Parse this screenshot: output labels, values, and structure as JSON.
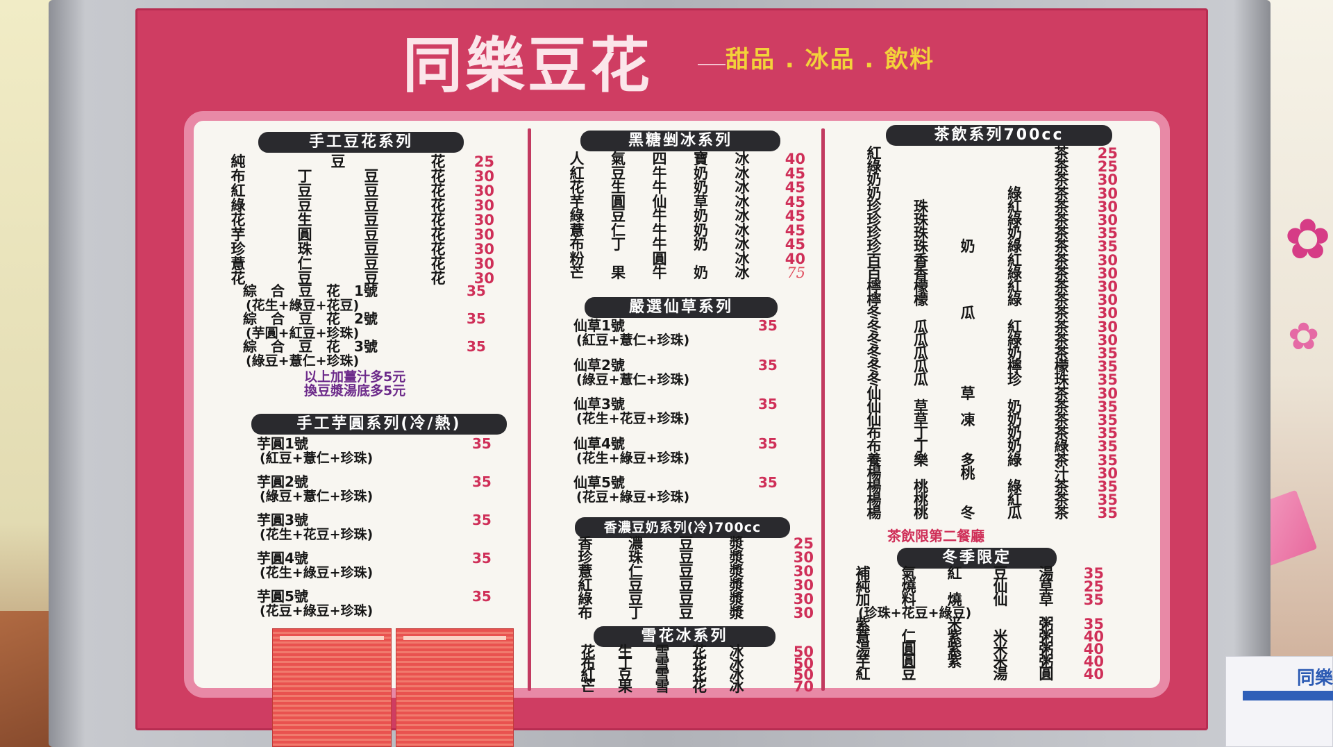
{
  "brand": {
    "name": "同樂豆花",
    "slogan": "甜品 . 冰品 . 飲料"
  },
  "colors": {
    "board": "#cf3d62",
    "price": "#cf2f58",
    "header_bg": "#2a2a2e",
    "inner": "#f8f6f1",
    "accent_note": "#6c2a8a"
  },
  "douhua": {
    "title": "手工豆花系列",
    "items": [
      {
        "name": [
          "純",
          "豆",
          "花"
        ],
        "price": "25"
      },
      {
        "name": [
          "布",
          "丁",
          "豆",
          "花"
        ],
        "price": "30"
      },
      {
        "name": [
          "紅",
          "豆",
          "豆",
          "花"
        ],
        "price": "30"
      },
      {
        "name": [
          "綠",
          "豆",
          "豆",
          "花"
        ],
        "price": "30"
      },
      {
        "name": [
          "花",
          "生",
          "豆",
          "花"
        ],
        "price": "30"
      },
      {
        "name": [
          "芋",
          "圓",
          "豆",
          "花"
        ],
        "price": "30"
      },
      {
        "name": [
          "珍",
          "珠",
          "豆",
          "花"
        ],
        "price": "30"
      },
      {
        "name": [
          "薏",
          "仁",
          "豆",
          "花"
        ],
        "price": "30"
      },
      {
        "name": [
          "花",
          "豆",
          "豆",
          "花"
        ],
        "price": "30"
      }
    ],
    "combos": [
      {
        "title": "綜　合　豆　花　1號",
        "price": "35",
        "sub": "(花生+綠豆+花豆)"
      },
      {
        "title": "綜　合　豆　花　2號",
        "price": "35",
        "sub": "(芋圓+紅豆+珍珠)"
      },
      {
        "title": "綜　合　豆　花　3號",
        "price": "35",
        "sub": "(綠豆+薏仁+珍珠)"
      }
    ],
    "notes": [
      "以上加薑汁多5元",
      "換豆漿湯底多5元"
    ]
  },
  "taro": {
    "title": "手工芋圓系列(冷/熱)",
    "items": [
      {
        "title": "芋圓1號",
        "price": "35",
        "sub": "(紅豆+薏仁+珍珠)"
      },
      {
        "title": "芋圓2號",
        "price": "35",
        "sub": "(綠豆+薏仁+珍珠)"
      },
      {
        "title": "芋圓3號",
        "price": "35",
        "sub": "(花生+花豆+珍珠)"
      },
      {
        "title": "芋圓4號",
        "price": "35",
        "sub": "(花生+綠豆+珍珠)"
      },
      {
        "title": "芋圓5號",
        "price": "35",
        "sub": "(花豆+綠豆+珍珠)"
      }
    ]
  },
  "brownsugar": {
    "title": "黑糖剉冰系列",
    "items": [
      {
        "name": [
          "人",
          "氣",
          "四",
          "寶",
          "冰"
        ],
        "price": "40"
      },
      {
        "name": [
          "紅",
          "豆",
          "牛",
          "奶",
          "冰"
        ],
        "price": "45"
      },
      {
        "name": [
          "花",
          "生",
          "牛",
          "奶",
          "冰"
        ],
        "price": "45"
      },
      {
        "name": [
          "芋",
          "圓",
          "仙",
          "草",
          "冰"
        ],
        "price": "45"
      },
      {
        "name": [
          "綠",
          "豆",
          "牛",
          "奶",
          "冰"
        ],
        "price": "45"
      },
      {
        "name": [
          "薏",
          "仁",
          "牛",
          "奶",
          "冰"
        ],
        "price": "45"
      },
      {
        "name": [
          "布",
          "丁",
          "牛",
          "奶",
          "冰"
        ],
        "price": "45"
      },
      {
        "name": [
          "粉",
          "",
          "圓",
          "",
          "冰"
        ],
        "price": "40"
      },
      {
        "name": [
          "芒",
          "果",
          "牛",
          "奶",
          "冰"
        ],
        "price": "75",
        "handwritten": true
      }
    ]
  },
  "grassjelly": {
    "title": "嚴選仙草系列",
    "items": [
      {
        "title": "仙草1號",
        "price": "35",
        "sub": "(紅豆+薏仁+珍珠)"
      },
      {
        "title": "仙草2號",
        "price": "35",
        "sub": "(綠豆+薏仁+珍珠)"
      },
      {
        "title": "仙草3號",
        "price": "35",
        "sub": "(花生+花豆+珍珠)"
      },
      {
        "title": "仙草4號",
        "price": "35",
        "sub": "(花生+綠豆+珍珠)"
      },
      {
        "title": "仙草5號",
        "price": "35",
        "sub": "(花豆+綠豆+珍珠)"
      }
    ]
  },
  "soymilk": {
    "title": "香濃豆奶系列(冷)700cc",
    "items": [
      {
        "name": [
          "香",
          "濃",
          "豆",
          "漿"
        ],
        "price": "25"
      },
      {
        "name": [
          "珍",
          "珠",
          "豆",
          "漿"
        ],
        "price": "30"
      },
      {
        "name": [
          "薏",
          "仁",
          "豆",
          "漿"
        ],
        "price": "30"
      },
      {
        "name": [
          "紅",
          "豆",
          "豆",
          "漿"
        ],
        "price": "30"
      },
      {
        "name": [
          "綠",
          "豆",
          "豆",
          "漿"
        ],
        "price": "30"
      },
      {
        "name": [
          "布",
          "丁",
          "豆",
          "漿"
        ],
        "price": "30"
      }
    ]
  },
  "snow": {
    "title": "雪花冰系列",
    "items": [
      {
        "name": [
          "花",
          "生",
          "雪",
          "花",
          "冰"
        ],
        "price": "50"
      },
      {
        "name": [
          "布",
          "丁",
          "雪",
          "花",
          "冰"
        ],
        "price": "50"
      },
      {
        "name": [
          "紅",
          "豆",
          "雪",
          "花",
          "冰"
        ],
        "price": "50"
      },
      {
        "name": [
          "芒",
          "果",
          "雪",
          "花",
          "冰"
        ],
        "price": "70"
      }
    ]
  },
  "tea": {
    "title": "茶飲系列700cc",
    "items": [
      {
        "name": [
          "紅",
          "",
          "",
          "",
          "茶"
        ],
        "price": "25"
      },
      {
        "name": [
          "綠",
          "",
          "",
          "",
          "茶"
        ],
        "price": "25"
      },
      {
        "name": [
          "奶",
          "",
          "",
          "",
          "茶"
        ],
        "price": "30"
      },
      {
        "name": [
          "奶",
          "",
          "",
          "綠",
          "茶"
        ],
        "price": "30"
      },
      {
        "name": [
          "珍",
          "珠",
          "",
          "紅",
          "茶"
        ],
        "price": "30"
      },
      {
        "name": [
          "珍",
          "珠",
          "",
          "綠",
          "茶"
        ],
        "price": "30"
      },
      {
        "name": [
          "珍",
          "珠",
          "",
          "奶",
          "茶"
        ],
        "price": "35"
      },
      {
        "name": [
          "珍",
          "珠",
          "奶",
          "綠",
          "茶"
        ],
        "price": "35"
      },
      {
        "name": [
          "百",
          "香",
          "",
          "紅",
          "茶"
        ],
        "price": "30"
      },
      {
        "name": [
          "百",
          "香",
          "",
          "綠",
          "茶"
        ],
        "price": "30"
      },
      {
        "name": [
          "檸",
          "檬",
          "",
          "紅",
          "茶"
        ],
        "price": "30"
      },
      {
        "name": [
          "檸",
          "檬",
          "",
          "綠",
          "茶"
        ],
        "price": "30"
      },
      {
        "name": [
          "冬",
          "",
          "瓜",
          "",
          "茶"
        ],
        "price": "30"
      },
      {
        "name": [
          "冬",
          "瓜",
          "",
          "紅",
          "茶"
        ],
        "price": "30"
      },
      {
        "name": [
          "冬",
          "瓜",
          "",
          "綠",
          "茶"
        ],
        "price": "30"
      },
      {
        "name": [
          "冬",
          "瓜",
          "",
          "奶",
          "茶"
        ],
        "price": "35"
      },
      {
        "name": [
          "冬",
          "瓜",
          "",
          "檸",
          "檬"
        ],
        "price": "35"
      },
      {
        "name": [
          "冬",
          "瓜",
          "",
          "珍",
          "珠"
        ],
        "price": "35"
      },
      {
        "name": [
          "仙",
          "",
          "草",
          "",
          "茶"
        ],
        "price": "30"
      },
      {
        "name": [
          "仙",
          "草",
          "",
          "奶",
          "茶"
        ],
        "price": "35"
      },
      {
        "name": [
          "仙",
          "草",
          "凍",
          "奶",
          "茶"
        ],
        "price": "35"
      },
      {
        "name": [
          "布",
          "丁",
          "",
          "奶",
          "茶"
        ],
        "price": "35"
      },
      {
        "name": [
          "布",
          "丁",
          "",
          "奶",
          "綠"
        ],
        "price": "35"
      },
      {
        "name": [
          "養",
          "樂",
          "多",
          "綠",
          "茶"
        ],
        "price": "35"
      },
      {
        "name": [
          "楊",
          "",
          "桃",
          "",
          "汁"
        ],
        "price": "30"
      },
      {
        "name": [
          "楊",
          "桃",
          "",
          "綠",
          "茶"
        ],
        "price": "35"
      },
      {
        "name": [
          "楊",
          "桃",
          "",
          "紅",
          "茶"
        ],
        "price": "35"
      },
      {
        "name": [
          "楊",
          "桃",
          "冬",
          "瓜",
          "茶"
        ],
        "price": "35"
      }
    ],
    "note": "茶飲限第二餐廳"
  },
  "winter": {
    "title": "冬季限定",
    "items": [
      {
        "name": [
          "補",
          "氣",
          "紅",
          "豆",
          "湯"
        ],
        "price": "35"
      },
      {
        "name": [
          "純",
          "燒",
          "",
          "仙",
          "草"
        ],
        "price": "25"
      },
      {
        "name": [
          "加",
          "料",
          "燒",
          "仙",
          "草"
        ],
        "price": "35"
      }
    ],
    "combo_sub": "(珍珠+花豆+綠豆)",
    "items2": [
      {
        "name": [
          "紫",
          "",
          "米",
          "",
          "粥"
        ],
        "price": "35"
      },
      {
        "name": [
          "薏",
          "仁",
          "紫",
          "米",
          "粥"
        ],
        "price": "40"
      },
      {
        "name": [
          "湯",
          "圓",
          "紫",
          "米",
          "粥"
        ],
        "price": "40"
      },
      {
        "name": [
          "芋",
          "圓",
          "紫",
          "米",
          "粥"
        ],
        "price": "40"
      },
      {
        "name": [
          "紅",
          "豆",
          "",
          "湯",
          "圓"
        ],
        "price": "40"
      }
    ]
  },
  "card": {
    "title": "同樂"
  }
}
